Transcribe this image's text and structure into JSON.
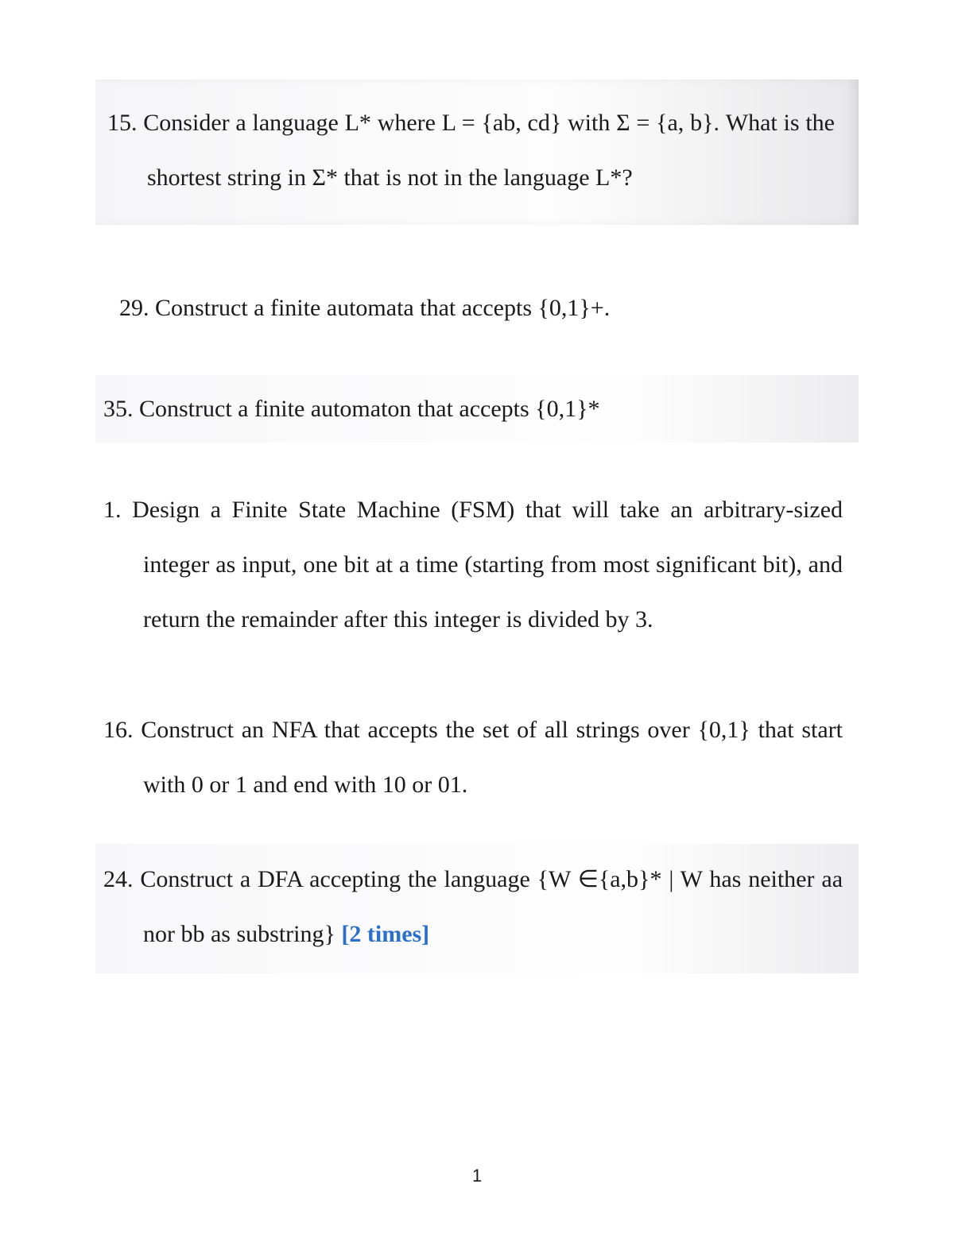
{
  "questions": {
    "q15": {
      "number": "15.",
      "text": "Consider a language L* where L = {ab, cd} with Σ = {a, b}. What is the shortest string in Σ* that is not in the language L*?"
    },
    "q29": {
      "number": "29.",
      "text": "Construct a finite automata that accepts {0,1}+."
    },
    "q35": {
      "number": "35.",
      "text": "Construct a finite automaton that accepts {0,1}*"
    },
    "q1": {
      "number": "1.",
      "text": "Design a Finite State Machine (FSM) that will take an arbitrary-sized integer as input, one bit at a time (starting from most significant bit), and return the remainder after this integer is divided by 3."
    },
    "q16": {
      "number": "16.",
      "text": "Construct an NFA that accepts the set of all strings over {0,1} that start with 0 or 1 and end with 10 or 01."
    },
    "q24": {
      "number": "24.",
      "text_part1": "Construct a DFA accepting the language {W ∈{a,b}* | W has neither aa nor bb as substring}",
      "highlight": "[2 times]"
    }
  },
  "page_number": "1"
}
